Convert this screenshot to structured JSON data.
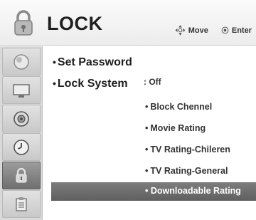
{
  "header": {
    "title": "LOCK",
    "hint_move": "Move",
    "hint_enter": "Enter"
  },
  "sidebar": {
    "items": [
      {
        "icon": "picture-icon"
      },
      {
        "icon": "screen-icon"
      },
      {
        "icon": "speaker-icon"
      },
      {
        "icon": "clock-icon"
      },
      {
        "icon": "lock-icon",
        "active": true
      },
      {
        "icon": "option-icon"
      }
    ]
  },
  "menu": {
    "items": [
      {
        "label": "Set Password"
      },
      {
        "label": "Lock System",
        "value": ": Off"
      }
    ]
  },
  "submenu": {
    "items": [
      {
        "label": "Block Chennel"
      },
      {
        "label": "Movie Rating"
      },
      {
        "label": "TV Rating-Chileren"
      },
      {
        "label": "TV Rating-General"
      },
      {
        "label": "Downloadable Rating",
        "selected": true
      }
    ]
  },
  "colors": {
    "highlight": "#6a6a6a",
    "sidebar_active": "#7f7f7f"
  }
}
